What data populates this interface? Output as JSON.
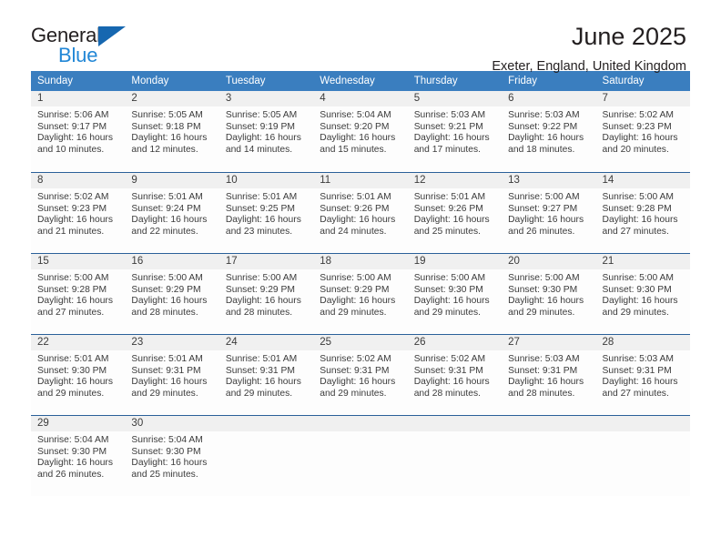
{
  "logo": {
    "word_one": "General",
    "word_two": "Blue",
    "triangle_color": "#1667b0",
    "blue_color": "#2287d6"
  },
  "header": {
    "title": "June 2025",
    "subtitle": "Exeter, England, United Kingdom"
  },
  "theme": {
    "header_blue": "#3a7ebf",
    "row_divider_blue": "#2a6099",
    "daynum_band": "#f0f0f0",
    "text": "#3b3b3b"
  },
  "weekday_headers": [
    "Sunday",
    "Monday",
    "Tuesday",
    "Wednesday",
    "Thursday",
    "Friday",
    "Saturday"
  ],
  "labels": {
    "sunrise_prefix": "Sunrise:",
    "sunset_prefix": "Sunset:",
    "daylight_prefix": "Daylight:"
  },
  "weeks": [
    [
      {
        "day": "1",
        "sunrise": "Sunrise: 5:06 AM",
        "sunset": "Sunset: 9:17 PM",
        "daylight_line1": "Daylight: 16 hours",
        "daylight_line2": "and 10 minutes."
      },
      {
        "day": "2",
        "sunrise": "Sunrise: 5:05 AM",
        "sunset": "Sunset: 9:18 PM",
        "daylight_line1": "Daylight: 16 hours",
        "daylight_line2": "and 12 minutes."
      },
      {
        "day": "3",
        "sunrise": "Sunrise: 5:05 AM",
        "sunset": "Sunset: 9:19 PM",
        "daylight_line1": "Daylight: 16 hours",
        "daylight_line2": "and 14 minutes."
      },
      {
        "day": "4",
        "sunrise": "Sunrise: 5:04 AM",
        "sunset": "Sunset: 9:20 PM",
        "daylight_line1": "Daylight: 16 hours",
        "daylight_line2": "and 15 minutes."
      },
      {
        "day": "5",
        "sunrise": "Sunrise: 5:03 AM",
        "sunset": "Sunset: 9:21 PM",
        "daylight_line1": "Daylight: 16 hours",
        "daylight_line2": "and 17 minutes."
      },
      {
        "day": "6",
        "sunrise": "Sunrise: 5:03 AM",
        "sunset": "Sunset: 9:22 PM",
        "daylight_line1": "Daylight: 16 hours",
        "daylight_line2": "and 18 minutes."
      },
      {
        "day": "7",
        "sunrise": "Sunrise: 5:02 AM",
        "sunset": "Sunset: 9:23 PM",
        "daylight_line1": "Daylight: 16 hours",
        "daylight_line2": "and 20 minutes."
      }
    ],
    [
      {
        "day": "8",
        "sunrise": "Sunrise: 5:02 AM",
        "sunset": "Sunset: 9:23 PM",
        "daylight_line1": "Daylight: 16 hours",
        "daylight_line2": "and 21 minutes."
      },
      {
        "day": "9",
        "sunrise": "Sunrise: 5:01 AM",
        "sunset": "Sunset: 9:24 PM",
        "daylight_line1": "Daylight: 16 hours",
        "daylight_line2": "and 22 minutes."
      },
      {
        "day": "10",
        "sunrise": "Sunrise: 5:01 AM",
        "sunset": "Sunset: 9:25 PM",
        "daylight_line1": "Daylight: 16 hours",
        "daylight_line2": "and 23 minutes."
      },
      {
        "day": "11",
        "sunrise": "Sunrise: 5:01 AM",
        "sunset": "Sunset: 9:26 PM",
        "daylight_line1": "Daylight: 16 hours",
        "daylight_line2": "and 24 minutes."
      },
      {
        "day": "12",
        "sunrise": "Sunrise: 5:01 AM",
        "sunset": "Sunset: 9:26 PM",
        "daylight_line1": "Daylight: 16 hours",
        "daylight_line2": "and 25 minutes."
      },
      {
        "day": "13",
        "sunrise": "Sunrise: 5:00 AM",
        "sunset": "Sunset: 9:27 PM",
        "daylight_line1": "Daylight: 16 hours",
        "daylight_line2": "and 26 minutes."
      },
      {
        "day": "14",
        "sunrise": "Sunrise: 5:00 AM",
        "sunset": "Sunset: 9:28 PM",
        "daylight_line1": "Daylight: 16 hours",
        "daylight_line2": "and 27 minutes."
      }
    ],
    [
      {
        "day": "15",
        "sunrise": "Sunrise: 5:00 AM",
        "sunset": "Sunset: 9:28 PM",
        "daylight_line1": "Daylight: 16 hours",
        "daylight_line2": "and 27 minutes."
      },
      {
        "day": "16",
        "sunrise": "Sunrise: 5:00 AM",
        "sunset": "Sunset: 9:29 PM",
        "daylight_line1": "Daylight: 16 hours",
        "daylight_line2": "and 28 minutes."
      },
      {
        "day": "17",
        "sunrise": "Sunrise: 5:00 AM",
        "sunset": "Sunset: 9:29 PM",
        "daylight_line1": "Daylight: 16 hours",
        "daylight_line2": "and 28 minutes."
      },
      {
        "day": "18",
        "sunrise": "Sunrise: 5:00 AM",
        "sunset": "Sunset: 9:29 PM",
        "daylight_line1": "Daylight: 16 hours",
        "daylight_line2": "and 29 minutes."
      },
      {
        "day": "19",
        "sunrise": "Sunrise: 5:00 AM",
        "sunset": "Sunset: 9:30 PM",
        "daylight_line1": "Daylight: 16 hours",
        "daylight_line2": "and 29 minutes."
      },
      {
        "day": "20",
        "sunrise": "Sunrise: 5:00 AM",
        "sunset": "Sunset: 9:30 PM",
        "daylight_line1": "Daylight: 16 hours",
        "daylight_line2": "and 29 minutes."
      },
      {
        "day": "21",
        "sunrise": "Sunrise: 5:00 AM",
        "sunset": "Sunset: 9:30 PM",
        "daylight_line1": "Daylight: 16 hours",
        "daylight_line2": "and 29 minutes."
      }
    ],
    [
      {
        "day": "22",
        "sunrise": "Sunrise: 5:01 AM",
        "sunset": "Sunset: 9:30 PM",
        "daylight_line1": "Daylight: 16 hours",
        "daylight_line2": "and 29 minutes."
      },
      {
        "day": "23",
        "sunrise": "Sunrise: 5:01 AM",
        "sunset": "Sunset: 9:31 PM",
        "daylight_line1": "Daylight: 16 hours",
        "daylight_line2": "and 29 minutes."
      },
      {
        "day": "24",
        "sunrise": "Sunrise: 5:01 AM",
        "sunset": "Sunset: 9:31 PM",
        "daylight_line1": "Daylight: 16 hours",
        "daylight_line2": "and 29 minutes."
      },
      {
        "day": "25",
        "sunrise": "Sunrise: 5:02 AM",
        "sunset": "Sunset: 9:31 PM",
        "daylight_line1": "Daylight: 16 hours",
        "daylight_line2": "and 29 minutes."
      },
      {
        "day": "26",
        "sunrise": "Sunrise: 5:02 AM",
        "sunset": "Sunset: 9:31 PM",
        "daylight_line1": "Daylight: 16 hours",
        "daylight_line2": "and 28 minutes."
      },
      {
        "day": "27",
        "sunrise": "Sunrise: 5:03 AM",
        "sunset": "Sunset: 9:31 PM",
        "daylight_line1": "Daylight: 16 hours",
        "daylight_line2": "and 28 minutes."
      },
      {
        "day": "28",
        "sunrise": "Sunrise: 5:03 AM",
        "sunset": "Sunset: 9:31 PM",
        "daylight_line1": "Daylight: 16 hours",
        "daylight_line2": "and 27 minutes."
      }
    ],
    [
      {
        "day": "29",
        "sunrise": "Sunrise: 5:04 AM",
        "sunset": "Sunset: 9:30 PM",
        "daylight_line1": "Daylight: 16 hours",
        "daylight_line2": "and 26 minutes."
      },
      {
        "day": "30",
        "sunrise": "Sunrise: 5:04 AM",
        "sunset": "Sunset: 9:30 PM",
        "daylight_line1": "Daylight: 16 hours",
        "daylight_line2": "and 25 minutes."
      },
      {
        "day": "",
        "sunrise": "",
        "sunset": "",
        "daylight_line1": "",
        "daylight_line2": ""
      },
      {
        "day": "",
        "sunrise": "",
        "sunset": "",
        "daylight_line1": "",
        "daylight_line2": ""
      },
      {
        "day": "",
        "sunrise": "",
        "sunset": "",
        "daylight_line1": "",
        "daylight_line2": ""
      },
      {
        "day": "",
        "sunrise": "",
        "sunset": "",
        "daylight_line1": "",
        "daylight_line2": ""
      },
      {
        "day": "",
        "sunrise": "",
        "sunset": "",
        "daylight_line1": "",
        "daylight_line2": ""
      }
    ]
  ]
}
